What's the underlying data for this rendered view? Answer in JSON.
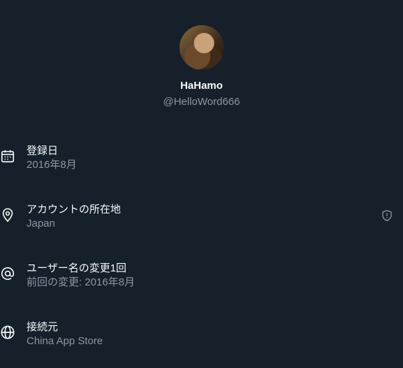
{
  "profile": {
    "display_name": "HaHamo",
    "handle": "@HelloWord666"
  },
  "rows": [
    {
      "icon": "calendar-icon",
      "label": "登録日",
      "value": "2016年8月"
    },
    {
      "icon": "location-pin-icon",
      "label": "アカウントの所在地",
      "value": "Japan",
      "badge_icon": "shield-icon"
    },
    {
      "icon": "at-sign-icon",
      "label": "ユーザー名の変更1回",
      "value": "前回の変更: 2016年8月"
    },
    {
      "icon": "globe-icon",
      "label": "接続元",
      "value": "China App Store"
    }
  ],
  "colors": {
    "background": "#15202b",
    "primary_text": "#f7f9f9",
    "secondary_text": "#8b98a5"
  }
}
